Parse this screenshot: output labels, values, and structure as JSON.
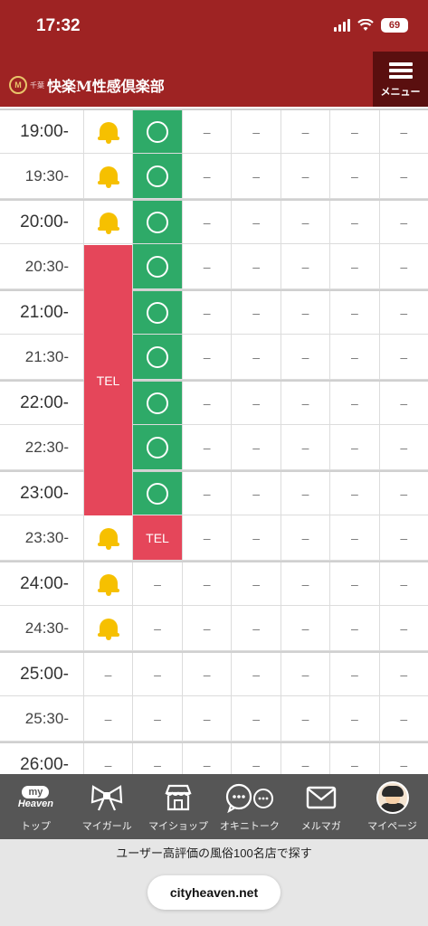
{
  "status_bar": {
    "time": "17:32",
    "battery": "69"
  },
  "header": {
    "logo_small": "千葉",
    "logo_text": "快楽M性感倶楽部",
    "menu_label": "メニュー",
    "brand_color": "#9e2323"
  },
  "schedule": {
    "rows": [
      {
        "time": "19:00-",
        "hour": true,
        "bell": true,
        "avail": "circle"
      },
      {
        "time": "19:30-",
        "hour": false,
        "bell": true,
        "avail": "circle"
      },
      {
        "time": "20:00-",
        "hour": true,
        "bell": true,
        "avail": "circle"
      },
      {
        "time": "20:30-",
        "hour": false,
        "bell": false,
        "avail": "circle"
      },
      {
        "time": "21:00-",
        "hour": true,
        "bell": false,
        "avail": "circle"
      },
      {
        "time": "21:30-",
        "hour": false,
        "bell": false,
        "avail": "circle"
      },
      {
        "time": "22:00-",
        "hour": true,
        "bell": true,
        "avail": "circle"
      },
      {
        "time": "22:30-",
        "hour": false,
        "bell": true,
        "avail": "circle"
      },
      {
        "time": "23:00-",
        "hour": true,
        "bell": true,
        "avail": "circle"
      },
      {
        "time": "23:30-",
        "hour": false,
        "bell": true,
        "avail": "tel"
      },
      {
        "time": "24:00-",
        "hour": true,
        "bell": true,
        "avail": "dash"
      },
      {
        "time": "24:30-",
        "hour": false,
        "bell": true,
        "avail": "dash"
      },
      {
        "time": "25:00-",
        "hour": true,
        "bell": false,
        "avail": "dash"
      },
      {
        "time": "25:30-",
        "hour": false,
        "bell": false,
        "avail": "dash"
      },
      {
        "time": "26:00-",
        "hour": true,
        "bell": false,
        "avail": "dash"
      }
    ],
    "tel_block_label": "TEL",
    "tel_label": "TEL",
    "dash": "–",
    "colors": {
      "available": "#2eaa68",
      "tel": "#e5465a",
      "bell": "#f6c000"
    }
  },
  "nav": {
    "items": [
      {
        "label": "トップ",
        "icon": "myheaven-icon",
        "logo_top": "my",
        "logo_bottom": "Heaven"
      },
      {
        "label": "マイガール",
        "icon": "ribbon-icon"
      },
      {
        "label": "マイショップ",
        "icon": "shop-icon"
      },
      {
        "label": "オキニトーク",
        "icon": "chat-icon"
      },
      {
        "label": "メルマガ",
        "icon": "mail-icon"
      },
      {
        "label": "マイページ",
        "icon": "avatar-icon"
      }
    ]
  },
  "footer": {
    "text": "ユーザー高評価の風俗100名店で探す",
    "url": "cityheaven.net"
  }
}
